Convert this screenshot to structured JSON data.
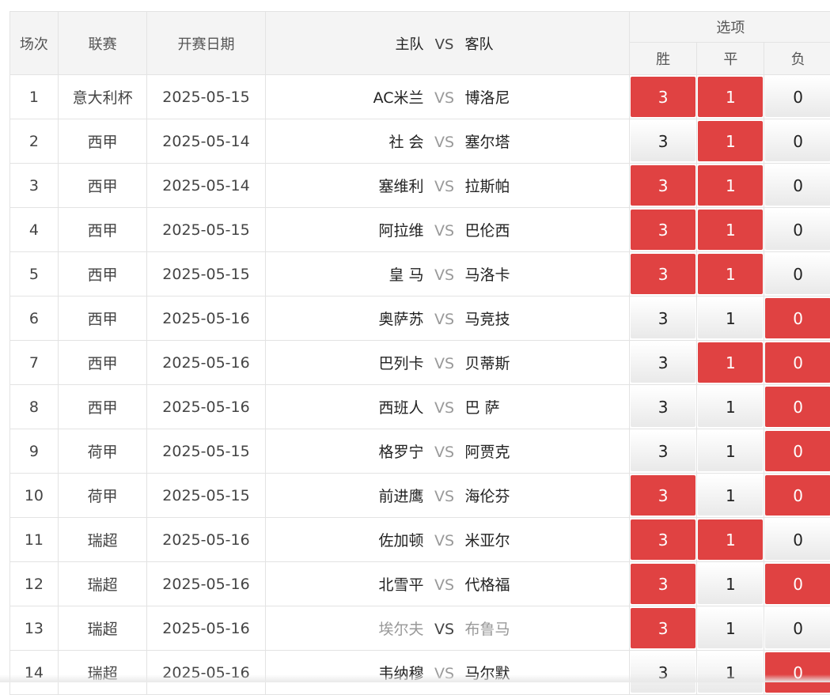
{
  "header": {
    "no": "场次",
    "league": "联赛",
    "date": "开赛日期",
    "home": "主队",
    "vs": "VS",
    "away": "客队",
    "options": "选项",
    "win": "胜",
    "draw": "平",
    "lose": "负"
  },
  "colors": {
    "selected": "#e04242",
    "header_bg": "#f4f4f4"
  },
  "rows": [
    {
      "no": "1",
      "league": "意大利杯",
      "date": "2025-05-15",
      "home": "AC米兰",
      "vs": "VS",
      "away": "博洛尼",
      "w": "3",
      "d": "1",
      "l": "0",
      "ws": true,
      "ds": true,
      "ls": false,
      "muted": false
    },
    {
      "no": "2",
      "league": "西甲",
      "date": "2025-05-14",
      "home": "社 会",
      "vs": "VS",
      "away": "塞尔塔",
      "w": "3",
      "d": "1",
      "l": "0",
      "ws": false,
      "ds": true,
      "ls": false,
      "muted": false
    },
    {
      "no": "3",
      "league": "西甲",
      "date": "2025-05-14",
      "home": "塞维利",
      "vs": "VS",
      "away": "拉斯帕",
      "w": "3",
      "d": "1",
      "l": "0",
      "ws": true,
      "ds": true,
      "ls": false,
      "muted": false
    },
    {
      "no": "4",
      "league": "西甲",
      "date": "2025-05-15",
      "home": "阿拉维",
      "vs": "VS",
      "away": "巴伦西",
      "w": "3",
      "d": "1",
      "l": "0",
      "ws": true,
      "ds": true,
      "ls": false,
      "muted": false
    },
    {
      "no": "5",
      "league": "西甲",
      "date": "2025-05-15",
      "home": "皇 马",
      "vs": "VS",
      "away": "马洛卡",
      "w": "3",
      "d": "1",
      "l": "0",
      "ws": true,
      "ds": true,
      "ls": false,
      "muted": false
    },
    {
      "no": "6",
      "league": "西甲",
      "date": "2025-05-16",
      "home": "奥萨苏",
      "vs": "VS",
      "away": "马竞技",
      "w": "3",
      "d": "1",
      "l": "0",
      "ws": false,
      "ds": false,
      "ls": true,
      "muted": false
    },
    {
      "no": "7",
      "league": "西甲",
      "date": "2025-05-16",
      "home": "巴列卡",
      "vs": "VS",
      "away": "贝蒂斯",
      "w": "3",
      "d": "1",
      "l": "0",
      "ws": false,
      "ds": true,
      "ls": true,
      "muted": false
    },
    {
      "no": "8",
      "league": "西甲",
      "date": "2025-05-16",
      "home": "西班人",
      "vs": "VS",
      "away": "巴 萨",
      "w": "3",
      "d": "1",
      "l": "0",
      "ws": false,
      "ds": false,
      "ls": true,
      "muted": false
    },
    {
      "no": "9",
      "league": "荷甲",
      "date": "2025-05-15",
      "home": "格罗宁",
      "vs": "VS",
      "away": "阿贾克",
      "w": "3",
      "d": "1",
      "l": "0",
      "ws": false,
      "ds": false,
      "ls": true,
      "muted": false
    },
    {
      "no": "10",
      "league": "荷甲",
      "date": "2025-05-15",
      "home": "前进鹰",
      "vs": "VS",
      "away": "海伦芬",
      "w": "3",
      "d": "1",
      "l": "0",
      "ws": true,
      "ds": false,
      "ls": true,
      "muted": false
    },
    {
      "no": "11",
      "league": "瑞超",
      "date": "2025-05-16",
      "home": "佐加顿",
      "vs": "VS",
      "away": "米亚尔",
      "w": "3",
      "d": "1",
      "l": "0",
      "ws": true,
      "ds": true,
      "ls": false,
      "muted": false
    },
    {
      "no": "12",
      "league": "瑞超",
      "date": "2025-05-16",
      "home": "北雪平",
      "vs": "VS",
      "away": "代格福",
      "w": "3",
      "d": "1",
      "l": "0",
      "ws": true,
      "ds": false,
      "ls": true,
      "muted": false
    },
    {
      "no": "13",
      "league": "瑞超",
      "date": "2025-05-16",
      "home": "埃尔夫",
      "vs": "VS",
      "away": "布鲁马",
      "w": "3",
      "d": "1",
      "l": "0",
      "ws": true,
      "ds": false,
      "ls": false,
      "muted": true
    },
    {
      "no": "14",
      "league": "瑞超",
      "date": "2025-05-16",
      "home": "韦纳穆",
      "vs": "VS",
      "away": "马尔默",
      "w": "3",
      "d": "1",
      "l": "0",
      "ws": false,
      "ds": false,
      "ls": true,
      "muted": false
    }
  ]
}
